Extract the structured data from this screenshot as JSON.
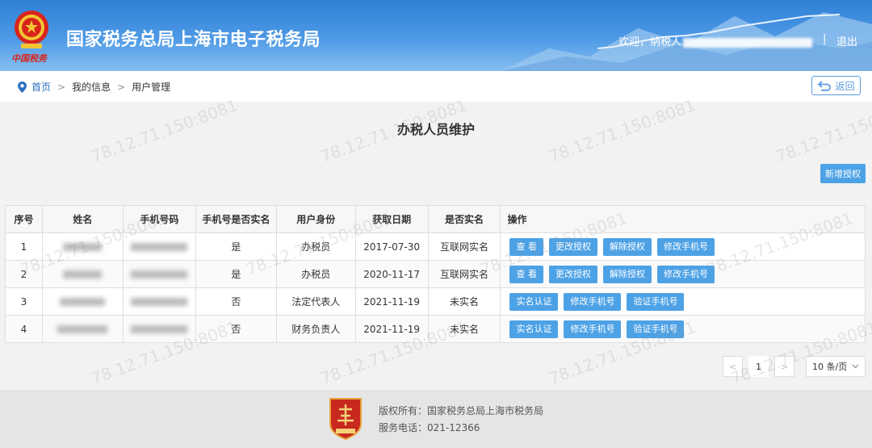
{
  "header": {
    "site_title": "国家税务总局上海市电子税务局",
    "emblem_text": "中国税务",
    "welcome": "欢迎，纳税人",
    "separator": "|",
    "logout": "退出"
  },
  "breadcrumb": {
    "home": "首页",
    "separator": ">",
    "items": [
      "我的信息",
      "用户管理"
    ]
  },
  "back_button": {
    "label": "返回"
  },
  "page_title": "办税人员维护",
  "add_button": {
    "label": "新增授权"
  },
  "table": {
    "headers": [
      "序号",
      "姓名",
      "手机号码",
      "手机号是否实名",
      "用户身份",
      "获取日期",
      "是否实名",
      "操作"
    ],
    "rows": [
      {
        "index": "1",
        "phone_verified": "是",
        "role": "办税员",
        "date": "2017-07-30",
        "realname": "互联网实名",
        "actions": [
          "查 看",
          "更改授权",
          "解除授权",
          "修改手机号"
        ]
      },
      {
        "index": "2",
        "phone_verified": "是",
        "role": "办税员",
        "date": "2020-11-17",
        "realname": "互联网实名",
        "actions": [
          "查 看",
          "更改授权",
          "解除授权",
          "修改手机号"
        ]
      },
      {
        "index": "3",
        "phone_verified": "否",
        "role": "法定代表人",
        "date": "2021-11-19",
        "realname": "未实名",
        "actions": [
          "实名认证",
          "修改手机号",
          "验证手机号"
        ]
      },
      {
        "index": "4",
        "phone_verified": "否",
        "role": "财务负责人",
        "date": "2021-11-19",
        "realname": "未实名",
        "actions": [
          "实名认证",
          "修改手机号",
          "验证手机号"
        ]
      }
    ]
  },
  "pagination": {
    "prev": "<",
    "current_page": "1",
    "next": ">",
    "page_size": "10 条/页"
  },
  "footer": {
    "copyright": "版权所有：国家税务总局上海市税务局",
    "phone": "服务电话：021-12366"
  },
  "watermark": "78.12.71.150:8081",
  "colors": {
    "header_blue": "#2f7fd6",
    "button_blue": "#4da2e6",
    "link_blue": "#2c6ebf"
  }
}
